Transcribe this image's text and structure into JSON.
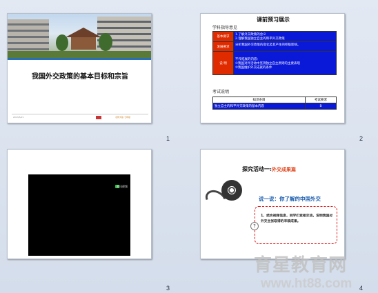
{
  "slides": [
    {
      "number": "1",
      "title": "我国外交政策的基本目标和宗旨",
      "footer_left": "2013/5/21",
      "footer_right": "北师大版 七年级"
    },
    {
      "number": "2",
      "title": "课前预习展示",
      "section1": "学科指导意见",
      "rows": [
        {
          "label": "基本要求",
          "lines": [
            "1.了解外交政策的含义",
            "2.理解我国独立自主的和平外交政策"
          ]
        },
        {
          "label": "发展要求",
          "lines": [
            "分析我国外交政策的变化及其产生的积极影响。"
          ]
        },
        {
          "label": "说  明",
          "lines": [
            "不作拓展的内容：",
            "①我国对外活动中坚持独立自主原则的主要表现",
            "②我国维护外交成就的条件"
          ]
        }
      ],
      "section2": "考试说明",
      "exam_headers": [
        "知识条目",
        "考试要求"
      ],
      "exam_row": [
        "独立自主的和平外交政策的基本内容",
        "B"
      ]
    },
    {
      "number": "3",
      "video_label": "腾讯视频"
    },
    {
      "number": "4",
      "heading_main": "探究活动一:",
      "heading_accent": "外交成果篇",
      "subheading": "说一说：你了解的中国外交",
      "question_mark": "?",
      "box_text": "1、结合视频信息，同学们竞相交流，说明我国对外交主张取得的丰硕成果。"
    }
  ],
  "watermark": {
    "main": "育星教育网",
    "url": "www.ht88.com"
  }
}
